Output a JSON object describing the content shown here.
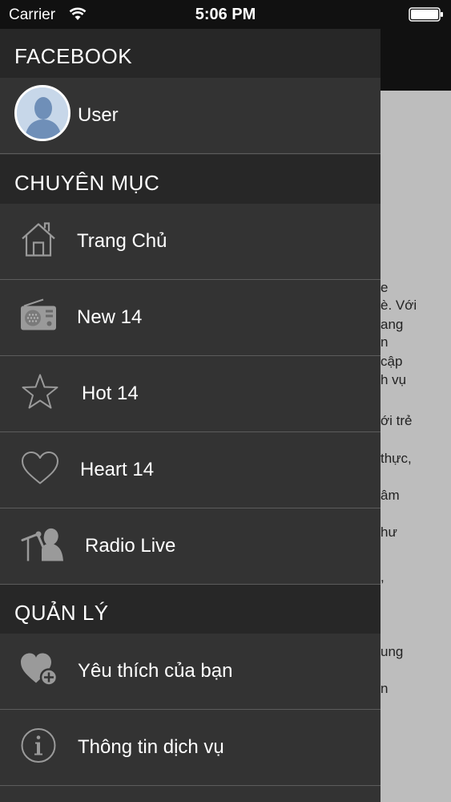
{
  "status_bar": {
    "carrier": "Carrier",
    "time": "5:06 PM",
    "wifi_icon": "wifi-icon",
    "battery_icon": "battery-icon"
  },
  "background": {
    "lines": [
      "e",
      "è. Với",
      "ang",
      "n",
      "cập",
      "h vụ",
      "ới trẻ",
      "thực,",
      "âm",
      "hư",
      ",",
      "ung",
      "n"
    ]
  },
  "drawer": {
    "facebook_header": "FACEBOOK",
    "user_name": "User",
    "avatar_icon": "avatar-silhouette-icon",
    "categories_header": "CHUYÊN MỤC",
    "categories": [
      {
        "label": "Trang Chủ",
        "icon": "home-icon"
      },
      {
        "label": "New 14",
        "icon": "radio-icon"
      },
      {
        "label": "Hot 14",
        "icon": "star-icon"
      },
      {
        "label": "Heart 14",
        "icon": "heart-icon"
      },
      {
        "label": "Radio Live",
        "icon": "microphone-singer-icon"
      }
    ],
    "manage_header": "QUẢN LÝ",
    "manage": [
      {
        "label": "Yêu thích của bạn",
        "icon": "heart-add-icon"
      },
      {
        "label": "Thông tin dịch vụ",
        "icon": "info-icon"
      }
    ]
  },
  "colors": {
    "drawer_bg": "#333333",
    "section_header_bg": "#272727",
    "divider": "#5c5c5c",
    "status_bar_bg": "#111111",
    "content_bg": "#bdbdbd",
    "text": "#ffffff",
    "icon_gray": "#9a9a9a"
  }
}
